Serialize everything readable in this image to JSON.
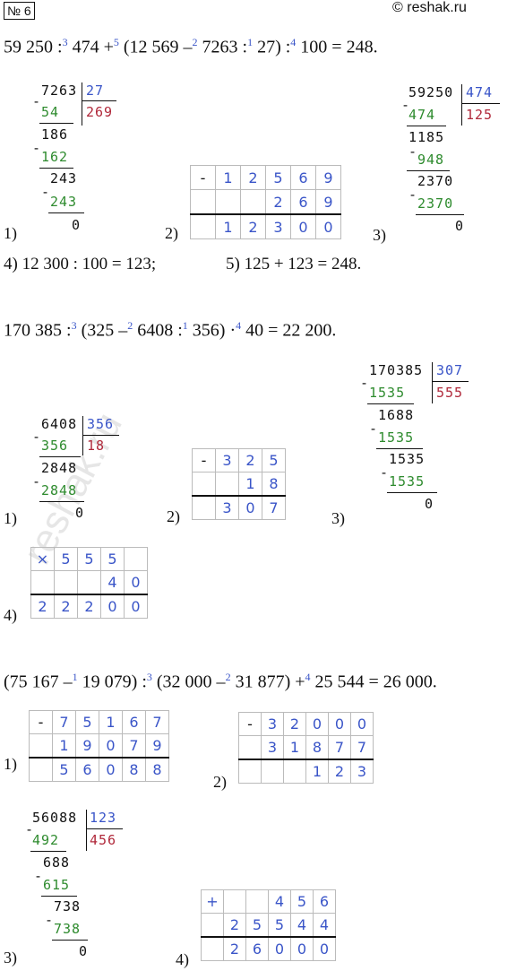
{
  "header": {
    "badge": "№ 6",
    "site": "© reshak.ru"
  },
  "watermark": "reshak.ru",
  "ex1": {
    "eq": {
      "a": "59 250 :",
      "o3": "3",
      "b": " 474 +",
      "o5": "5",
      "c": " (12 569 –",
      "o2": "2",
      "d": " 7263 :",
      "o1": "1",
      "e": " 27) :",
      "o4": "4",
      "f": " 100 = 248."
    },
    "div1": {
      "dividend": "7263",
      "divisor": "27",
      "quotient": "269",
      "s1": "54",
      "r1": "186",
      "s2": "162",
      "r2": "243",
      "s3": "243",
      "rem": "0"
    },
    "sub2": {
      "op": "-",
      "r1": [
        "",
        "1",
        "2",
        "5",
        "6",
        "9"
      ],
      "r2": [
        "",
        "",
        "",
        "2",
        "6",
        "9"
      ],
      "r3": [
        "",
        "1",
        "2",
        "3",
        "0",
        "0"
      ]
    },
    "div3": {
      "dividend": "59250",
      "divisor": "474",
      "quotient": "125",
      "s1": "474",
      "r1": "1185",
      "s2": "948",
      "r2": "2370",
      "s3": "2370",
      "rem": "0"
    },
    "labels": [
      "1)",
      "2)",
      "3)"
    ],
    "line4": "4) 12 300 : 100 = 123;",
    "line5": "5) 125 + 123 = 248."
  },
  "ex2": {
    "eq": {
      "a": "170 385 :",
      "o3": "3",
      "b": " (325 –",
      "o2": "2",
      "c": " 6408 :",
      "o1": "1",
      "d": " 356) ·",
      "o4": "4",
      "e": " 40 = 22 200."
    },
    "div1": {
      "dividend": "6408",
      "divisor": "356",
      "quotient": "18",
      "s1": "356",
      "r1": "2848",
      "s2": "2848",
      "rem": "0"
    },
    "sub2": {
      "op": "-",
      "r1": [
        "",
        "3",
        "2",
        "5"
      ],
      "r2": [
        "",
        "",
        "1",
        "8"
      ],
      "r3": [
        "",
        "3",
        "0",
        "7"
      ]
    },
    "div3": {
      "dividend": "170385",
      "divisor": "307",
      "quotient": "555",
      "s1": "1535",
      "r1": "1688",
      "s2": "1535",
      "r2": "1535",
      "s3": "1535",
      "rem": "0"
    },
    "mul4": {
      "op": "×",
      "r1": [
        "",
        "5",
        "5",
        "5",
        ""
      ],
      "r2": [
        "",
        "",
        "",
        "4",
        "0"
      ],
      "r3": [
        "2",
        "2",
        "2",
        "0",
        "0"
      ]
    },
    "labels": [
      "1)",
      "2)",
      "3)",
      "4)"
    ]
  },
  "ex3": {
    "eq": {
      "a": "(75 167 –",
      "o1": "1",
      "b": " 19 079) :",
      "o3": "3",
      "c": " (32 000 –",
      "o2": "2",
      "d": " 31 877) +",
      "o4": "4",
      "e": " 25 544 = 26 000."
    },
    "sub1": {
      "op": "-",
      "r1": [
        "",
        "7",
        "5",
        "1",
        "6",
        "7"
      ],
      "r2": [
        "",
        "1",
        "9",
        "0",
        "7",
        "9"
      ],
      "r3": [
        "",
        "5",
        "6",
        "0",
        "8",
        "8"
      ]
    },
    "sub2": {
      "op": "-",
      "r1": [
        "",
        "3",
        "2",
        "0",
        "0",
        "0"
      ],
      "r2": [
        "",
        "3",
        "1",
        "8",
        "7",
        "7"
      ],
      "r3": [
        "",
        "",
        "",
        "1",
        "2",
        "3"
      ]
    },
    "div3": {
      "dividend": "56088",
      "divisor": "123",
      "quotient": "456",
      "s1": "492",
      "r1": "688",
      "s2": "615",
      "r2": "738",
      "s3": "738",
      "rem": "0"
    },
    "add4": {
      "op": "+",
      "r1": [
        "",
        "",
        "",
        "4",
        "5",
        "6"
      ],
      "r2": [
        "",
        "2",
        "5",
        "5",
        "4",
        "4"
      ],
      "r3": [
        "",
        "2",
        "6",
        "0",
        "0",
        "0"
      ]
    },
    "labels": [
      "1)",
      "2)",
      "3)",
      "4)"
    ]
  }
}
